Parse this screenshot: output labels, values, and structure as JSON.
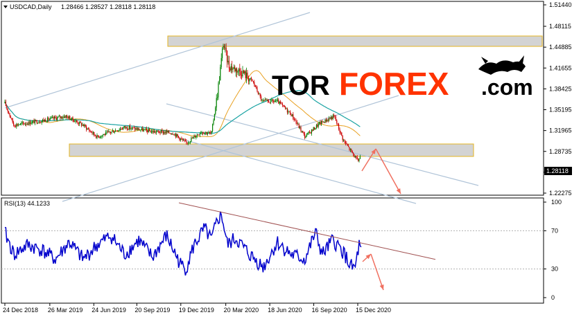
{
  "header": {
    "symbol": "USDCAD,Daily",
    "ohlc": "1.28466 1.28527 1.28118 1.28118",
    "dropdown_icon": "triangle-down-icon"
  },
  "logo": {
    "part1": "TOR",
    "part2": "FOREX",
    "part3": ".com",
    "colors": {
      "part1": "#000000",
      "part2": "#ff3300",
      "part3": "#000000"
    },
    "emblem": "bull-bear-icon"
  },
  "rsi_panel": {
    "label": "RSI(13) 44.1233",
    "ticks": [
      "100",
      "70",
      "30",
      "0"
    ]
  },
  "price_axis": {
    "ticks": [
      "1.51440",
      "1.48115",
      "1.44885",
      "1.41655",
      "1.38425",
      "1.35195",
      "1.31965",
      "1.28735",
      "1.25505",
      "1.22275"
    ],
    "current_price": "1.28118"
  },
  "time_axis": {
    "ticks": [
      "24 Dec 2018",
      "26 Mar 2019",
      "24 Jun 2019",
      "20 Sep 2019",
      "19 Dec 2019",
      "20 Mar 2020",
      "18 Jun 2020",
      "16 Sep 2020",
      "15 Dec 2020"
    ]
  },
  "colors": {
    "candle_up": "#008000",
    "candle_down": "#cc0000",
    "ma_fast": "#e8a020",
    "ma_slow": "#1aa3a3",
    "channel": "#b0c4d8",
    "zone_fill": "#d3d3d3",
    "zone_border": "#e6b422",
    "forecast_arrow": "#f07060",
    "rsi_line": "#0000cc",
    "rsi_trend": "#a05050"
  },
  "chart_data": [
    {
      "type": "candlestick",
      "title": "USDCAD,Daily",
      "ylim": [
        1.21,
        1.52
      ],
      "y_ticks": [
        1.2227,
        1.25505,
        1.28735,
        1.31965,
        1.35195,
        1.38425,
        1.41655,
        1.44885,
        1.48115,
        1.5144
      ],
      "x_ticks": [
        "24 Dec 2018",
        "26 Mar 2019",
        "24 Jun 2019",
        "20 Sep 2019",
        "19 Dec 2019",
        "20 Mar 2020",
        "18 Jun 2020",
        "16 Sep 2020",
        "15 Dec 2020"
      ],
      "close_path": [
        {
          "x": "24 Dec 2018",
          "y": 1.362
        },
        {
          "x": "10 Jan 2019",
          "y": 1.328
        },
        {
          "x": "26 Mar 2019",
          "y": 1.338
        },
        {
          "x": "24 Jun 2019",
          "y": 1.327
        },
        {
          "x": "20 Sep 2019",
          "y": 1.318
        },
        {
          "x": "19 Dec 2019",
          "y": 1.312
        },
        {
          "x": "20 Mar 2020",
          "y": 1.455
        },
        {
          "x": "18 Jun 2020",
          "y": 1.358
        },
        {
          "x": "16 Sep 2020",
          "y": 1.318
        },
        {
          "x": "15 Dec 2020",
          "y": 1.281
        }
      ],
      "last_price": 1.28118
    },
    {
      "type": "line",
      "title": "RSI(13) 44.1233",
      "ylim": [
        0,
        100
      ],
      "y_ticks": [
        0,
        30,
        70,
        100
      ],
      "series": [
        {
          "name": "RSI(13)",
          "points": [
            {
              "x": "24 Dec 2018",
              "y": 68
            },
            {
              "x": "26 Mar 2019",
              "y": 50
            },
            {
              "x": "24 Jun 2019",
              "y": 45
            },
            {
              "x": "20 Sep 2019",
              "y": 48
            },
            {
              "x": "19 Dec 2019",
              "y": 40
            },
            {
              "x": "20 Mar 2020",
              "y": 86
            },
            {
              "x": "18 Jun 2020",
              "y": 38
            },
            {
              "x": "16 Sep 2020",
              "y": 58
            },
            {
              "x": "15 Dec 2020",
              "y": 44
            }
          ]
        }
      ]
    }
  ]
}
